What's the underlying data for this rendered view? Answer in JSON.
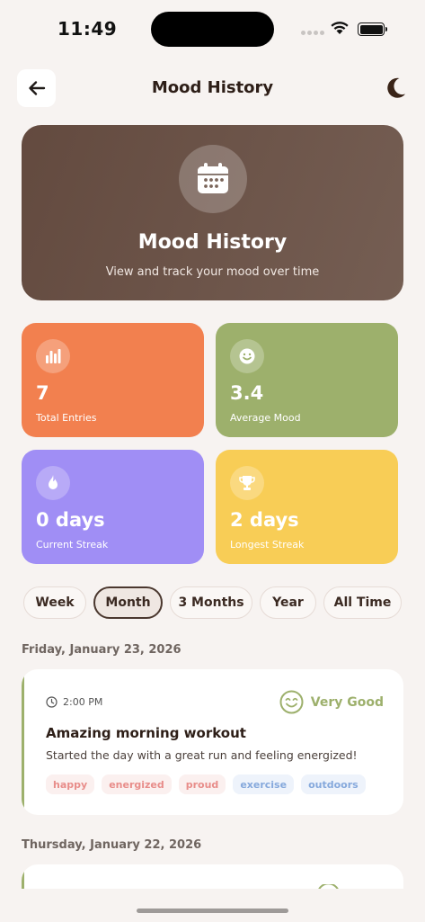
{
  "status": {
    "time": "11:49"
  },
  "nav": {
    "title": "Mood History"
  },
  "hero": {
    "title": "Mood History",
    "subtitle": "View and track your mood over time"
  },
  "stats": [
    {
      "value": "7",
      "label": "Total Entries",
      "icon": "bar-chart-icon",
      "color": "#f2804f"
    },
    {
      "value": "3.4",
      "label": "Average Mood",
      "icon": "smile-icon",
      "color": "#9db06c"
    },
    {
      "value": "0 days",
      "label": "Current Streak",
      "icon": "flame-icon",
      "color": "#a08ef5"
    },
    {
      "value": "2 days",
      "label": "Longest Streak",
      "icon": "trophy-icon",
      "color": "#f8cd56"
    }
  ],
  "filters": [
    {
      "label": "Week",
      "active": false
    },
    {
      "label": "Month",
      "active": true
    },
    {
      "label": "3 Months",
      "active": false
    },
    {
      "label": "Year",
      "active": false
    },
    {
      "label": "All Time",
      "active": false
    }
  ],
  "groups": [
    {
      "date": "Friday, January 23, 2026",
      "entries": [
        {
          "time": "2:00 PM",
          "mood": "Very Good",
          "title": "Amazing morning workout",
          "description": "Started the day with a great run and feeling energized!",
          "tags": [
            {
              "label": "happy",
              "kind": "emotion"
            },
            {
              "label": "energized",
              "kind": "emotion"
            },
            {
              "label": "proud",
              "kind": "emotion"
            },
            {
              "label": "exercise",
              "kind": "activity"
            },
            {
              "label": "outdoors",
              "kind": "activity"
            }
          ]
        }
      ]
    },
    {
      "date": "Thursday, January 22, 2026",
      "entries": []
    }
  ],
  "colors": {
    "accent": "#4a372e",
    "veryGood": "#9db06c",
    "background": "#f7f3f1"
  }
}
